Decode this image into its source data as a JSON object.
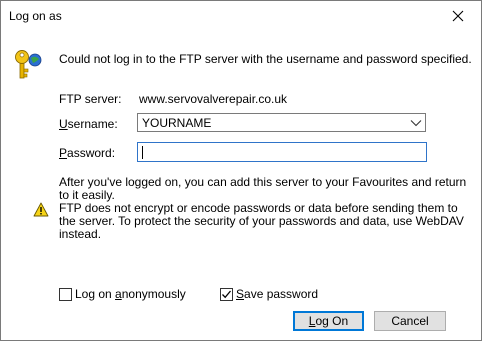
{
  "window": {
    "title": "Log on as"
  },
  "message": "Could not log in to the FTP server with the username and password specified.",
  "fields": {
    "server_label": "FTP server:",
    "server_value": "www.servovalverepair.co.uk",
    "username_label_u": "U",
    "username_label_rest": "sername:",
    "username_value": "YOURNAME",
    "password_label_u": "P",
    "password_label_rest": "assword:",
    "password_value": ""
  },
  "info": {
    "favourites_text": "After you've logged on, you can add this server to your Favourites and return to it easily.",
    "warning_text": "FTP does not encrypt or encode passwords or data before sending them to the server. To protect the security of your passwords and data, use WebDAV instead."
  },
  "options": {
    "anonymous_before": "Log on ",
    "anonymous_u": "a",
    "anonymous_after": "nonymously",
    "anonymous_checked": false,
    "save_u": "S",
    "save_after": "ave password",
    "save_checked": true
  },
  "buttons": {
    "logon_u": "L",
    "logon_after": "og On",
    "cancel": "Cancel"
  },
  "icons": {
    "title_close": "close-icon",
    "key": "key-icon",
    "warning": "warning-icon",
    "dropdown": "chevron-down-icon",
    "checkmark": "checkmark-icon"
  },
  "colors": {
    "focus_border": "#2f74c9",
    "button_face": "#e1e1e1",
    "default_button_border": "#0078d7",
    "warning_yellow": "#f7d417"
  }
}
